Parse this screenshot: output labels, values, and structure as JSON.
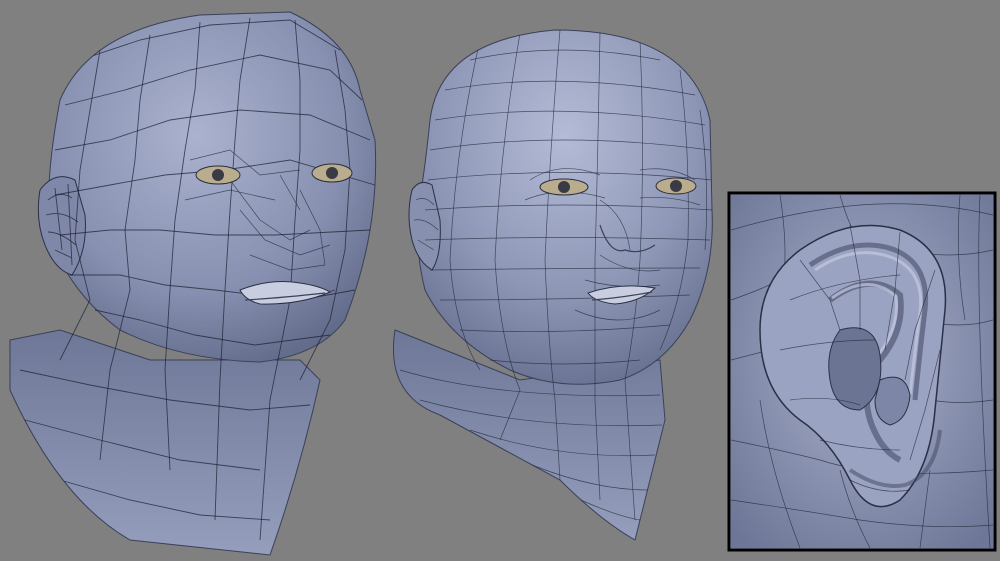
{
  "scene": {
    "background_color": "#808080",
    "mesh_color": "#8a93b3",
    "mesh_shadow_color": "#5d6685",
    "wire_color": "#1e2233",
    "inset_border_color": "#000000"
  },
  "panels": [
    {
      "name": "low-poly-head-mesh"
    },
    {
      "name": "subdivided-head-mesh"
    },
    {
      "name": "ear-closeup-inset"
    }
  ]
}
